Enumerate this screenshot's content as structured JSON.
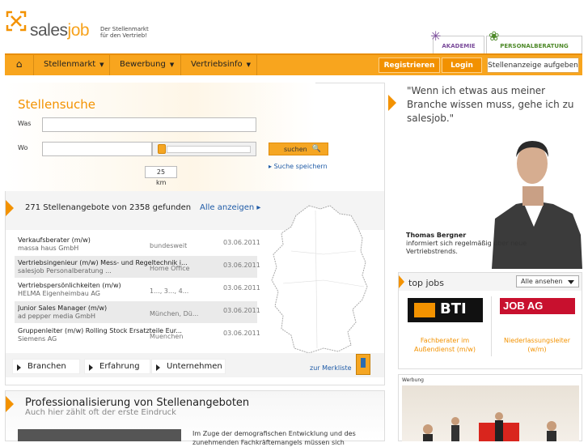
{
  "brand": {
    "logo_prefix": "sales",
    "logo_suffix": "job",
    "slogan": "Der Stellenmarkt für den Vertrieb!"
  },
  "top_tabs": [
    {
      "label": "AKADEMIE",
      "color": "#7b4c9b"
    },
    {
      "label": "PERSONALBERATUNG",
      "color": "#4f8a2a"
    }
  ],
  "nav": {
    "home_icon": "home-icon",
    "items": [
      "Stellenmarkt",
      "Bewerbung",
      "Vertriebsinfo"
    ],
    "registrieren": "Registrieren",
    "login": "Login",
    "aufgeben": "Stellenanzeige aufgeben",
    "accent": "#f8a51e"
  },
  "search": {
    "title": "Stellensuche",
    "was_label": "Was",
    "wo_label": "Wo",
    "was_value": "",
    "wo_value": "",
    "radius": "25",
    "unit": "km",
    "submit": "suchen",
    "save": "Suche speichern"
  },
  "results": {
    "summary": "271 Stellenangebote von 2358 gefunden",
    "all_link": "Alle anzeigen",
    "rows": [
      {
        "title": "Verkaufsberater (m/w)",
        "company": "massa haus GmbH",
        "location": "bundesweit",
        "date": "03.06.2011"
      },
      {
        "title": "Vertriebsingenieur (m/w) Mess- und Regeltechnik i...",
        "company": "salesjob Personalberatung ...",
        "location": "Home Office",
        "date": "03.06.2011"
      },
      {
        "title": "Vertriebspersönlichkeiten (m/w)",
        "company": "HELMA Eigenheimbau AG",
        "location": "1..., 3..., 4...",
        "date": "03.06.2011"
      },
      {
        "title": "Junior Sales Manager (m/w)",
        "company": "ad pepper media GmbH",
        "location": "München, Dü...",
        "date": "03.06.2011"
      },
      {
        "title": "Gruppenleiter (m/w) Rolling Stock Ersatzteile Eur...",
        "company": "Siemens AG",
        "location": "Muenchen",
        "date": "03.06.2011"
      }
    ]
  },
  "filters": {
    "branchen": "Branchen",
    "erfahrung": "Erfahrung",
    "unternehmen": "Unternehmen",
    "merkliste": "zur Merkliste"
  },
  "promo": {
    "title": "Professionalisierung von Stellenangeboten",
    "subtitle": "Auch hier zählt oft der erste Eindruck",
    "text": "Im Zuge der demografischen Entwicklung und des zunehmenden Fachkräftemangels müssen sich"
  },
  "testimonial": {
    "quote": "\"Wenn ich etwas aus meiner Branche wissen muss, gehe ich zu salesjob.\"",
    "name": "Thomas Bergner",
    "description": "informiert sich regelmäßig über neue Vertriebstrends."
  },
  "top_jobs": {
    "title": "top jobs",
    "select": "Alle ansehen",
    "jobs": [
      {
        "logo": "BTI",
        "title": "Fachberater im Außendienst (m/w)"
      },
      {
        "logo": "JOB AG",
        "title": "Niederlassungsleiter (w/m)"
      }
    ]
  },
  "ad": {
    "label": "Werbung"
  }
}
